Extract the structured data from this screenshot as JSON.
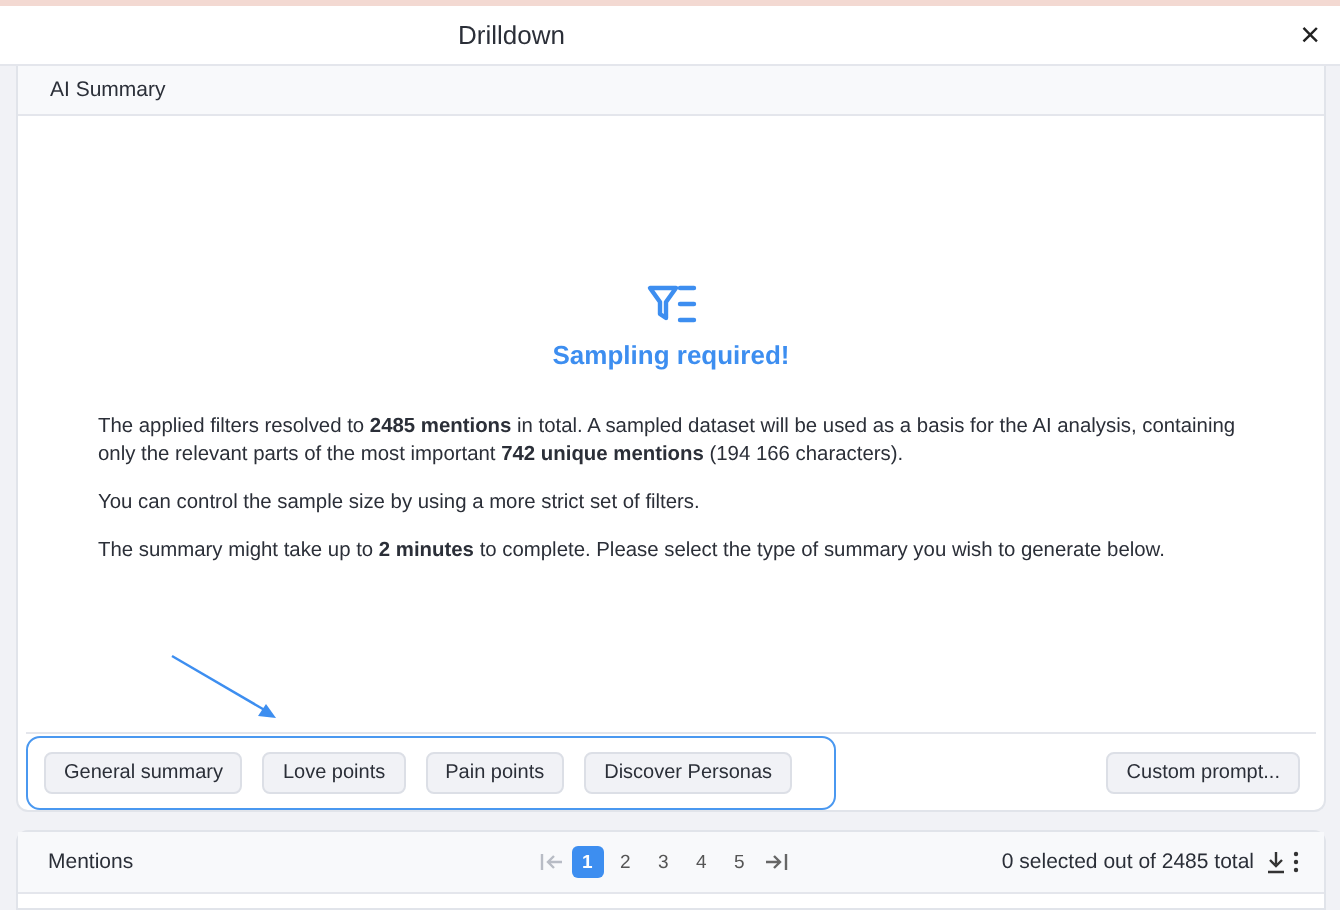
{
  "window": {
    "title": "Drilldown",
    "close": "×"
  },
  "summary_card": {
    "title": "AI Summary",
    "heading": "Sampling required!",
    "paragraphs": [
      "The applied filters resolved to **2485 mentions** in total. A sampled dataset will be used as a basis for the AI analysis, containing only the relevant parts of the most important **742 unique mentions** (194 166 characters).",
      "You can control the sample size by using a more strict set of filters.",
      "The summary might take up to **2 minutes** to complete. Please select the type of summary you wish to generate below."
    ],
    "summary_buttons": [
      "General summary",
      "Love points",
      "Pain points",
      "Discover Personas"
    ],
    "custom_button": "Custom prompt..."
  },
  "mentions_card": {
    "title": "Mentions",
    "pages": [
      {
        "label": "1",
        "selected": true
      },
      {
        "label": "2",
        "selected": false
      },
      {
        "label": "3",
        "selected": false
      },
      {
        "label": "4",
        "selected": false
      },
      {
        "label": "5",
        "selected": false
      }
    ],
    "count": "0 selected out of 2485 total"
  }
}
